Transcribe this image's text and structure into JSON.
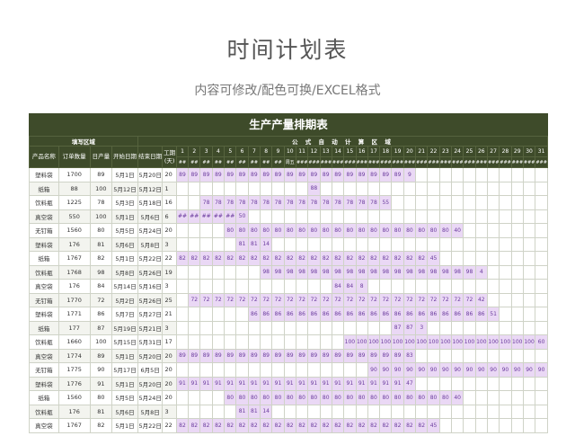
{
  "title": "时间计划表",
  "subtitle": "内容可修改/配色可换/EXCEL格式",
  "table_title": "生产产量排期表",
  "sections": {
    "input": "填写区域",
    "auto": "公 式 自 动 计 算 区 域"
  },
  "columns": {
    "product": "产品名称",
    "qty": "订单数量",
    "daily": "日产量",
    "start": "开始日期",
    "end": "结束日期",
    "duration": "工期(天)"
  },
  "days": [
    "1",
    "2",
    "3",
    "4",
    "5",
    "6",
    "7",
    "8",
    "9",
    "10",
    "11",
    "12",
    "13",
    "14",
    "15",
    "16",
    "17",
    "18",
    "19",
    "20",
    "21",
    "22",
    "23",
    "24",
    "25",
    "26",
    "27",
    "28",
    "29",
    "30",
    "31"
  ],
  "weekdays": [
    "##",
    "##",
    "##",
    "##",
    "##",
    "##",
    "##",
    "##",
    "##",
    "周五",
    "###",
    "###",
    "###",
    "###",
    "###",
    "###",
    "###",
    "###",
    "###",
    "###",
    "###",
    "###",
    "###",
    "###",
    "###",
    "###",
    "###",
    "###",
    "###",
    "###",
    "###"
  ],
  "rows": [
    {
      "product": "塑料袋",
      "qty": "1700",
      "daily": "89",
      "start": "5月1日",
      "end": "5月20日",
      "duration": "20",
      "from": 1,
      "to": 20,
      "value": "89",
      "last": "9"
    },
    {
      "product": "纸箱",
      "qty": "88",
      "daily": "100",
      "start": "5月12日",
      "end": "5月12日",
      "duration": "1",
      "from": 12,
      "to": 12,
      "value": "88",
      "last": "88"
    },
    {
      "product": "饮料瓶",
      "qty": "1225",
      "daily": "78",
      "start": "5月3日",
      "end": "5月18日",
      "duration": "16",
      "from": 3,
      "to": 18,
      "value": "78",
      "last": "55"
    },
    {
      "product": "真空袋",
      "qty": "550",
      "daily": "100",
      "start": "5月1日",
      "end": "5月6日",
      "duration": "6",
      "from": 1,
      "to": 6,
      "value": "##",
      "last": "50"
    },
    {
      "product": "无钉箱",
      "qty": "1560",
      "daily": "80",
      "start": "5月5日",
      "end": "5月24日",
      "duration": "20",
      "from": 5,
      "to": 24,
      "value": "80",
      "last": "40"
    },
    {
      "product": "塑料袋",
      "qty": "176",
      "daily": "81",
      "start": "5月6日",
      "end": "5月8日",
      "duration": "3",
      "from": 6,
      "to": 8,
      "value": "81",
      "last": "14"
    },
    {
      "product": "纸箱",
      "qty": "1767",
      "daily": "82",
      "start": "5月1日",
      "end": "5月22日",
      "duration": "22",
      "from": 1,
      "to": 22,
      "value": "82",
      "last": "45"
    },
    {
      "product": "饮料瓶",
      "qty": "1768",
      "daily": "98",
      "start": "5月8日",
      "end": "5月26日",
      "duration": "19",
      "from": 8,
      "to": 26,
      "value": "98",
      "last": "4"
    },
    {
      "product": "真空袋",
      "qty": "176",
      "daily": "84",
      "start": "5月14日",
      "end": "5月16日",
      "duration": "3",
      "from": 14,
      "to": 16,
      "value": "84",
      "last": "8"
    },
    {
      "product": "无钉箱",
      "qty": "1770",
      "daily": "72",
      "start": "5月2日",
      "end": "5月26日",
      "duration": "25",
      "from": 2,
      "to": 26,
      "value": "72",
      "last": "42"
    },
    {
      "product": "塑料袋",
      "qty": "1771",
      "daily": "86",
      "start": "5月7日",
      "end": "5月27日",
      "duration": "21",
      "from": 7,
      "to": 27,
      "value": "86",
      "last": "51"
    },
    {
      "product": "纸箱",
      "qty": "177",
      "daily": "87",
      "start": "5月19日",
      "end": "5月21日",
      "duration": "3",
      "from": 19,
      "to": 21,
      "value": "87",
      "last": "3"
    },
    {
      "product": "饮料瓶",
      "qty": "1660",
      "daily": "100",
      "start": "5月15日",
      "end": "5月31日",
      "duration": "17",
      "from": 15,
      "to": 31,
      "value": "100",
      "last": "60"
    },
    {
      "product": "真空袋",
      "qty": "1774",
      "daily": "89",
      "start": "5月1日",
      "end": "5月20日",
      "duration": "20",
      "from": 1,
      "to": 20,
      "value": "89",
      "last": "83"
    },
    {
      "product": "无钉箱",
      "qty": "1775",
      "daily": "90",
      "start": "5月17日",
      "end": "6月5日",
      "duration": "20",
      "from": 17,
      "to": 31,
      "value": "90",
      "last": "90"
    },
    {
      "product": "塑料袋",
      "qty": "1776",
      "daily": "91",
      "start": "5月1日",
      "end": "5月20日",
      "duration": "20",
      "from": 1,
      "to": 20,
      "value": "91",
      "last": "47"
    },
    {
      "product": "纸箱",
      "qty": "1560",
      "daily": "80",
      "start": "5月5日",
      "end": "5月24日",
      "duration": "20",
      "from": 5,
      "to": 24,
      "value": "80",
      "last": "40"
    },
    {
      "product": "饮料瓶",
      "qty": "176",
      "daily": "81",
      "start": "5月6日",
      "end": "5月8日",
      "duration": "3",
      "from": 6,
      "to": 8,
      "value": "81",
      "last": "14"
    },
    {
      "product": "真空袋",
      "qty": "1767",
      "daily": "82",
      "start": "5月1日",
      "end": "5月22日",
      "duration": "22",
      "from": 1,
      "to": 22,
      "value": "82",
      "last": "45"
    }
  ]
}
